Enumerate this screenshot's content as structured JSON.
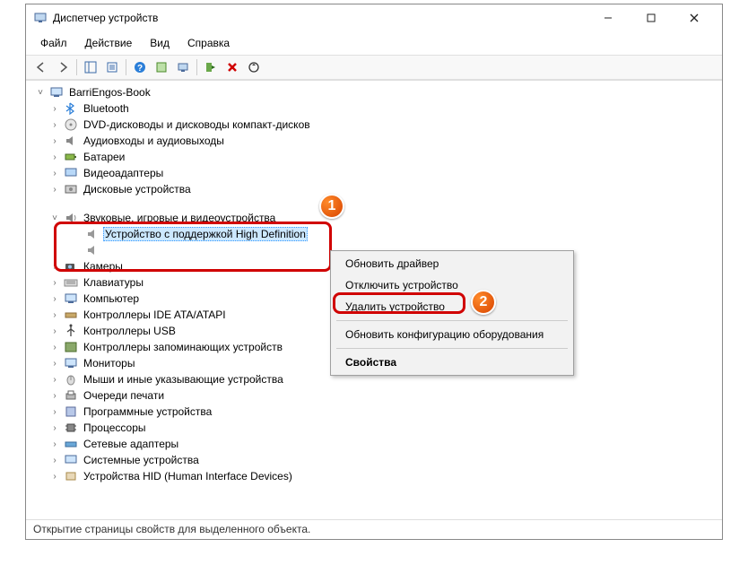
{
  "window_title": "Диспетчер устройств",
  "menu": {
    "file": "Файл",
    "action": "Действие",
    "view": "Вид",
    "help": "Справка"
  },
  "tree": {
    "root": "BarriEngos-Book",
    "items": [
      "Bluetooth",
      "DVD-дисководы и дисководы компакт-дисков",
      "Аудиовходы и аудиовыходы",
      "Батареи",
      "Видеоадаптеры",
      "Дисковые устройства"
    ],
    "sound_group": "Звуковые, игровые и видеоустройства",
    "sound_selected": "Устройство с поддержкой High Definition ",
    "items2": [
      "Камеры",
      "Клавиатуры",
      "Компьютер",
      "Контроллеры IDE ATA/ATAPI",
      "Контроллеры USB",
      "Контроллеры запоминающих устройств",
      "Мониторы",
      "Мыши и иные указывающие устройства",
      "Очереди печати",
      "Программные устройства",
      "Процессоры",
      "Сетевые адаптеры",
      "Системные устройства",
      "Устройства HID (Human Interface Devices)"
    ]
  },
  "context_menu": {
    "update_driver": "Обновить драйвер",
    "disable_device": "Отключить устройство",
    "delete_device": "Удалить устройство",
    "refresh_hw": "Обновить конфигурацию оборудования",
    "properties": "Свойства"
  },
  "statusbar": "Открытие страницы свойств для выделенного объекта.",
  "badges": {
    "one": "1",
    "two": "2"
  }
}
